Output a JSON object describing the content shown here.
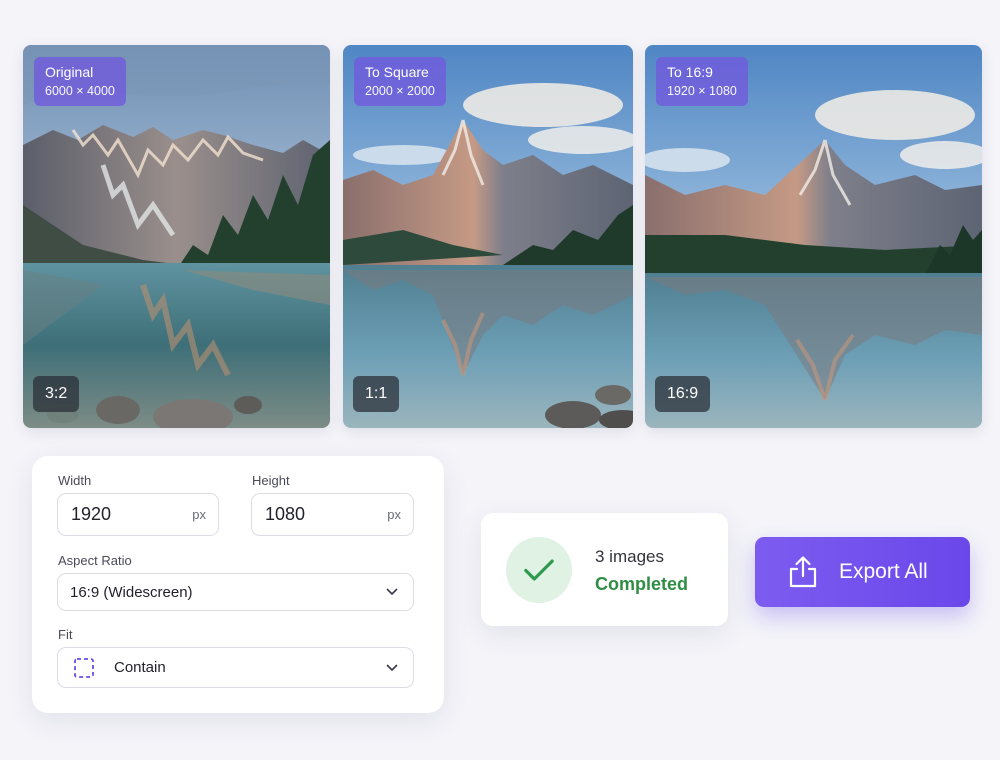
{
  "previews": [
    {
      "title": "Original",
      "dims": "6000 × 4000",
      "ratio": "3:2"
    },
    {
      "title": "To Square",
      "dims": "2000 × 2000",
      "ratio": "1:1"
    },
    {
      "title": "To 16:9",
      "dims": "1920 × 1080",
      "ratio": "16:9"
    }
  ],
  "settings": {
    "width_label": "Width",
    "width_value": "1920",
    "width_unit": "px",
    "height_label": "Height",
    "height_value": "1080",
    "height_unit": "px",
    "aspect_label": "Aspect Ratio",
    "aspect_value": "16:9 (Widescreen)",
    "fit_label": "Fit",
    "fit_value": "Contain"
  },
  "status": {
    "count": "3 images",
    "state": "Completed"
  },
  "export": {
    "label": "Export All"
  },
  "colors": {
    "accent": "#6f4fee",
    "success": "#2f8d44",
    "badge": "#705cdc"
  }
}
